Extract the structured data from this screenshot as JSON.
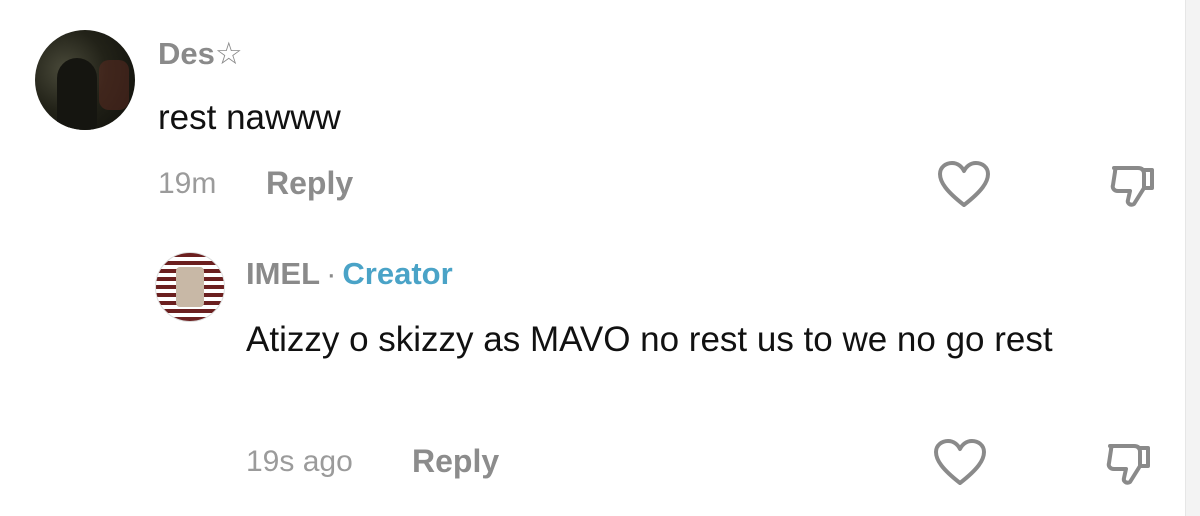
{
  "comments": [
    {
      "username": "Des",
      "username_suffix": "☆",
      "text": "rest nawww",
      "time": "19m",
      "reply_label": "Reply",
      "avatar_icon": "user-photo-avatar"
    }
  ],
  "replies": [
    {
      "username": "IMEL",
      "separator": "·",
      "badge": "Creator",
      "text": "Atizzy o skizzy as MAVO no rest us to we no go rest",
      "time": "19s ago",
      "reply_label": "Reply",
      "avatar_icon": "striped-emblem-avatar"
    }
  ],
  "colors": {
    "username": "#8a8a8a",
    "creator_badge": "#4aa3c7",
    "meta": "#9b9b9b",
    "text": "#111111",
    "icon_stroke": "#8a8a8a"
  },
  "icons": {
    "like": "heart-outline-icon",
    "dislike": "thumbs-down-outline-icon"
  }
}
